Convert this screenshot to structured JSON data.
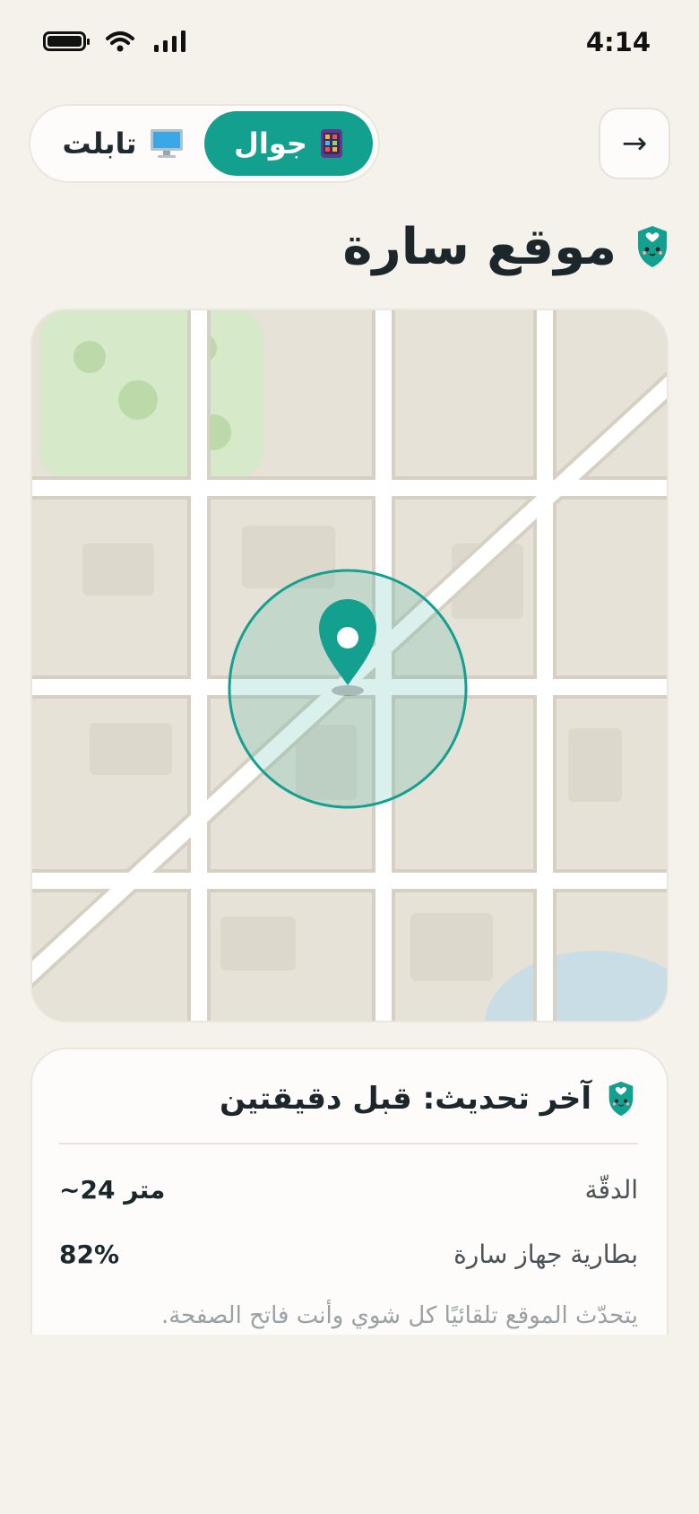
{
  "status_bar": {
    "time": "4:14"
  },
  "segmented": {
    "phone_label": "جوال",
    "tablet_label": "تابلت",
    "phone_icon": "phone-icon",
    "tablet_icon": "computer-icon",
    "selected": "جوال"
  },
  "back_button": {
    "label": "→"
  },
  "page": {
    "title": "موقع سارة",
    "title_icon": "shield-mascot-icon"
  },
  "map": {
    "marker_icon": "location-pin-icon",
    "accent": "#13a08f"
  },
  "info": {
    "heading": "آخر تحديث: قبل دقيقتين",
    "rows": [
      {
        "label": "الدقّة",
        "value": "~24 متر"
      },
      {
        "label": "بطارية جهاز سارة",
        "value": "82%"
      }
    ],
    "note": "يتحدّث الموقع تلقائيًا كل شوي وأنت فاتح الصفحة."
  },
  "colors": {
    "accent": "#13a08f",
    "background": "#f5f2ec",
    "card": "#fdfcfa"
  }
}
